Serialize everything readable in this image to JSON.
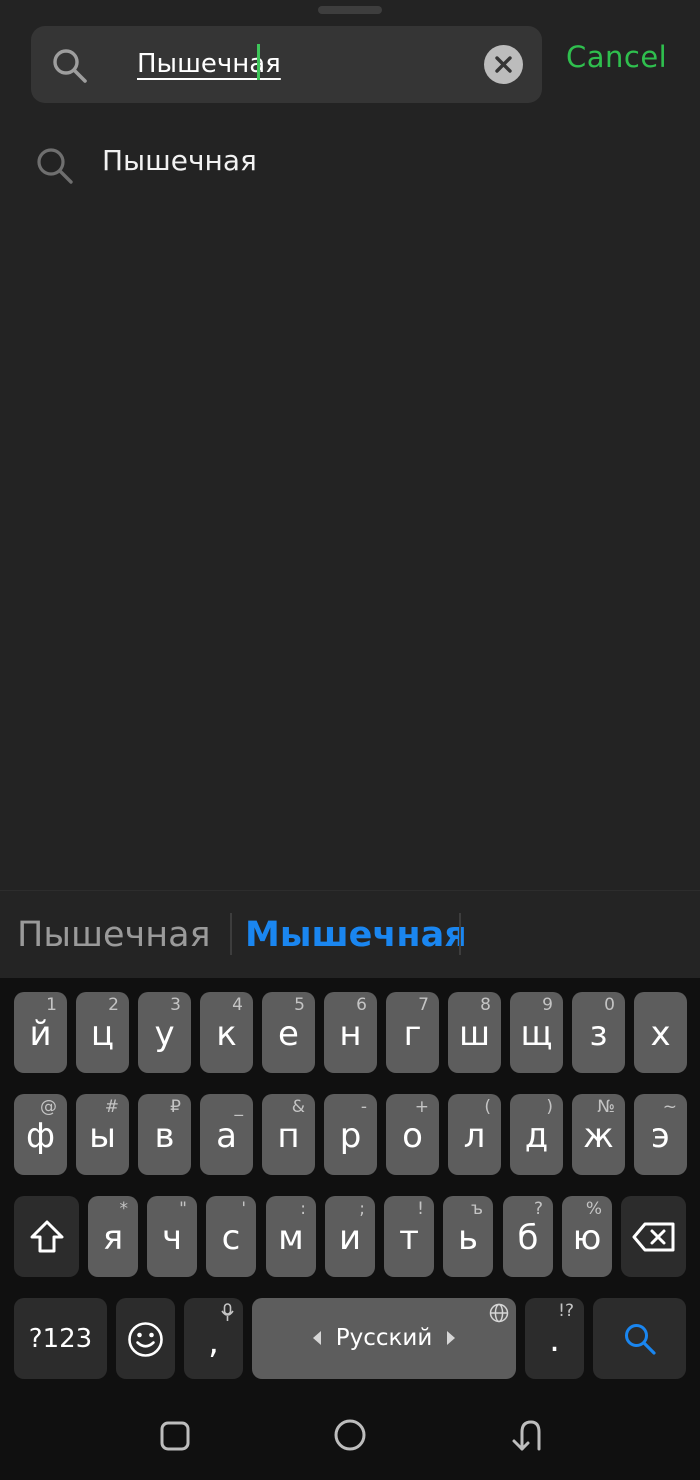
{
  "search": {
    "query": "Пышечная",
    "cancel_label": "Cancel"
  },
  "suggestions": [
    {
      "text": "Пышечная"
    }
  ],
  "word_suggestions": {
    "first": "Пышечная",
    "second": "Мышечная"
  },
  "keyboard": {
    "row1": [
      {
        "ch": "й",
        "hint": "1"
      },
      {
        "ch": "ц",
        "hint": "2"
      },
      {
        "ch": "у",
        "hint": "3"
      },
      {
        "ch": "к",
        "hint": "4"
      },
      {
        "ch": "е",
        "hint": "5"
      },
      {
        "ch": "н",
        "hint": "6"
      },
      {
        "ch": "г",
        "hint": "7"
      },
      {
        "ch": "ш",
        "hint": "8"
      },
      {
        "ch": "щ",
        "hint": "9"
      },
      {
        "ch": "з",
        "hint": "0"
      },
      {
        "ch": "х",
        "hint": ""
      }
    ],
    "row2": [
      {
        "ch": "ф",
        "hint": "@"
      },
      {
        "ch": "ы",
        "hint": "#"
      },
      {
        "ch": "в",
        "hint": "₽"
      },
      {
        "ch": "а",
        "hint": "_"
      },
      {
        "ch": "п",
        "hint": "&"
      },
      {
        "ch": "р",
        "hint": "-"
      },
      {
        "ch": "о",
        "hint": "+"
      },
      {
        "ch": "л",
        "hint": "("
      },
      {
        "ch": "д",
        "hint": ")"
      },
      {
        "ch": "ж",
        "hint": "№"
      },
      {
        "ch": "э",
        "hint": "~"
      }
    ],
    "row3": [
      {
        "ch": "я",
        "hint": "*"
      },
      {
        "ch": "ч",
        "hint": "\""
      },
      {
        "ch": "с",
        "hint": "'"
      },
      {
        "ch": "м",
        "hint": ":"
      },
      {
        "ch": "и",
        "hint": ";"
      },
      {
        "ch": "т",
        "hint": "!"
      },
      {
        "ch": "ь",
        "hint": "ъ"
      },
      {
        "ch": "б",
        "hint": "?"
      },
      {
        "ch": "ю",
        "hint": "%"
      }
    ],
    "symbols_label": "?123",
    "comma_label": ",",
    "space_label": "Русский",
    "period_label": ".",
    "period_hint": "!?"
  },
  "colors": {
    "accent_green": "#2fbf4e",
    "accent_blue": "#1a86f0"
  }
}
